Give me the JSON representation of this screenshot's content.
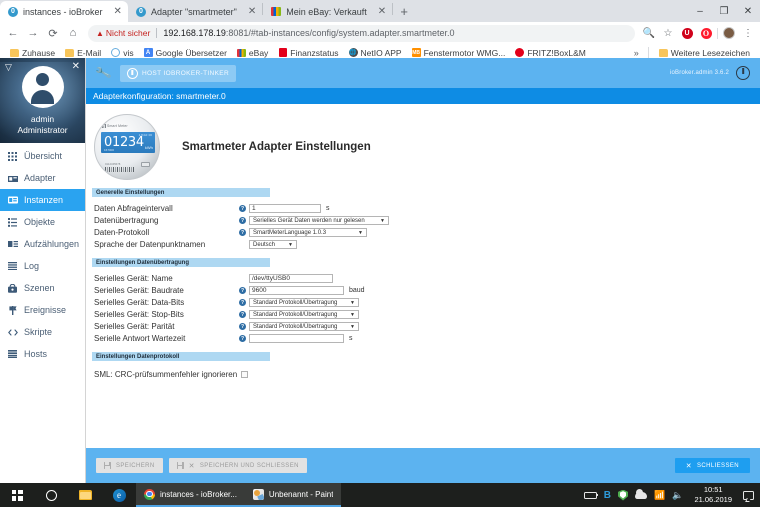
{
  "browser": {
    "tabs": [
      {
        "title": "instances - ioBroker",
        "icon": "iobroker-icon",
        "active": true
      },
      {
        "title": "Adapter \"smartmeter\"",
        "icon": "iobroker-icon",
        "active": false
      },
      {
        "title": "Mein eBay: Verkauft",
        "icon": "ebay-icon",
        "active": false
      }
    ],
    "new_tab_label": "+",
    "window_controls": {
      "minimize": "–",
      "maximize": "❐",
      "close": "✕"
    },
    "nav": {
      "back": "←",
      "forward": "→",
      "reload": "⟳",
      "home": "⌂"
    },
    "omnibox": {
      "security_label": "Nicht sicher",
      "url_host": "192.168.178.19",
      "url_rest": ":8081/#tab-instances/config/system.adapter.smartmeter.0",
      "zoom_icon": "search-icon",
      "bookmark_icon": "star-icon"
    },
    "extensions": {
      "ext1": "U",
      "ext2": "O"
    },
    "menu_icon": "⋮",
    "bookmarks": [
      {
        "label": "Zuhause",
        "icon": "folder-icon"
      },
      {
        "label": "E-Mail",
        "icon": "folder-icon"
      },
      {
        "label": "vis",
        "icon": "vis-icon"
      },
      {
        "label": "Google Übersetzer",
        "icon": "translate-icon"
      },
      {
        "label": "eBay",
        "icon": "ebay-icon"
      },
      {
        "label": "Finanzstatus",
        "icon": "sparkasse-icon"
      },
      {
        "label": "NetIO APP",
        "icon": "globe-icon"
      },
      {
        "label": "Fenstermotor WMG...",
        "icon": "mb-icon"
      },
      {
        "label": "FRITZ!BoxL&M",
        "icon": "fritzbox-icon"
      }
    ],
    "bookmarks_overflow": "»",
    "bookmarks_other": "Weitere Lesezeichen"
  },
  "sidebar": {
    "user": {
      "name": "admin",
      "role": "Administrator",
      "collapse_icon": "▽",
      "close_icon": "✕"
    },
    "items": [
      {
        "label": "Übersicht",
        "icon": "grid-icon",
        "active": false
      },
      {
        "label": "Adapter",
        "icon": "cart-icon",
        "active": false
      },
      {
        "label": "Instanzen",
        "icon": "instances-icon",
        "active": true
      },
      {
        "label": "Objekte",
        "icon": "list-icon",
        "active": false
      },
      {
        "label": "Aufzählungen",
        "icon": "enum-icon",
        "active": false
      },
      {
        "label": "Log",
        "icon": "lines-icon",
        "active": false
      },
      {
        "label": "Szenen",
        "icon": "scene-icon",
        "active": false
      },
      {
        "label": "Ereignisse",
        "icon": "flag-icon",
        "active": false
      },
      {
        "label": "Skripte",
        "icon": "code-icon",
        "active": false
      },
      {
        "label": "Hosts",
        "icon": "server-icon",
        "active": false
      }
    ]
  },
  "topbar": {
    "wrench_icon": "wrench-icon",
    "host_button": "HOST IOBROKER-TINKER",
    "version": "ioBroker.admin 3.6.2",
    "power_icon": "power-icon"
  },
  "page_title": "Adapterkonfiguration: smartmeter.0",
  "adapter": {
    "title": "Smartmeter Adapter Einstellungen",
    "logo_digits": "01234",
    "logo_unit": "kWh",
    "logo_brand": "Smart Meter",
    "logo_lcd_top": "1.8.0d: 00",
    "logo_lcd_bottom": "167000",
    "logo_serial": "0112345678"
  },
  "sections": {
    "general": "Generelle Einstellungen",
    "transfer": "Einstellungen Datenübertragung",
    "protocol": "Einstellungen Datenprotokoll"
  },
  "fields": {
    "general": [
      {
        "label": "Daten Abfrageintervall",
        "type": "input",
        "value": "1",
        "unit": "s",
        "hint": true,
        "width": "w-short"
      },
      {
        "label": "Datenübertragung",
        "type": "select",
        "value": "Serielles Gerät Daten werden nur gelesen",
        "hint": true,
        "width": "w1"
      },
      {
        "label": "Daten-Protokoll",
        "type": "select",
        "value": "SmartMeterLanguage 1.0.3",
        "hint": true,
        "width": "w2"
      },
      {
        "label": "Sprache der Datenpunktnamen",
        "type": "select",
        "value": "Deutsch",
        "hint": false,
        "width": "w3"
      }
    ],
    "transfer": [
      {
        "label": "Serielles Gerät: Name",
        "type": "input",
        "value": "/dev/ttyUSB0",
        "unit": "",
        "hint": false,
        "width": "w-long"
      },
      {
        "label": "Serielles Gerät: Baudrate",
        "type": "input",
        "value": "9600",
        "unit": "baud",
        "hint": true,
        "width": "w-med"
      },
      {
        "label": "Serielles Gerät: Data-Bits",
        "type": "select",
        "value": "Standard Protokoll/Übertragung",
        "hint": true,
        "width": "w4"
      },
      {
        "label": "Serielles Gerät: Stop-Bits",
        "type": "select",
        "value": "Standard Protokoll/Übertragung",
        "hint": true,
        "width": "w4"
      },
      {
        "label": "Serielles Gerät: Parität",
        "type": "select",
        "value": "Standard Protokoll/Übertragung",
        "hint": true,
        "width": "w4"
      },
      {
        "label": "Serielle Antwort Wartezeit",
        "type": "input",
        "value": "",
        "unit": "s",
        "hint": true,
        "width": "w-med"
      }
    ],
    "protocol": [
      {
        "label": "SML: CRC-prüfsummenfehler ignorieren",
        "type": "checkbox",
        "checked": false
      }
    ]
  },
  "buttons": {
    "save": "SPEICHERN",
    "save_close": "SPEICHERN UND SCHLIESSEN",
    "close": "SCHLIESSEN"
  },
  "taskbar": {
    "start_icon": "windows-icon",
    "cortana_icon": "cortana-icon",
    "explorer_icon": "file-explorer-icon",
    "edge_icon": "edge-icon",
    "windows": [
      {
        "label": "instances - ioBroker...",
        "icon": "chrome-icon"
      },
      {
        "label": "Unbenannt - Paint",
        "icon": "paint-icon"
      }
    ],
    "tray": [
      "battery-icon",
      "bluetooth-icon",
      "defender-icon",
      "onedrive-icon",
      "wifi-icon",
      "volume-icon"
    ],
    "time": "10:51",
    "date": "21.06.2019",
    "action_center_icon": "notification-icon"
  }
}
